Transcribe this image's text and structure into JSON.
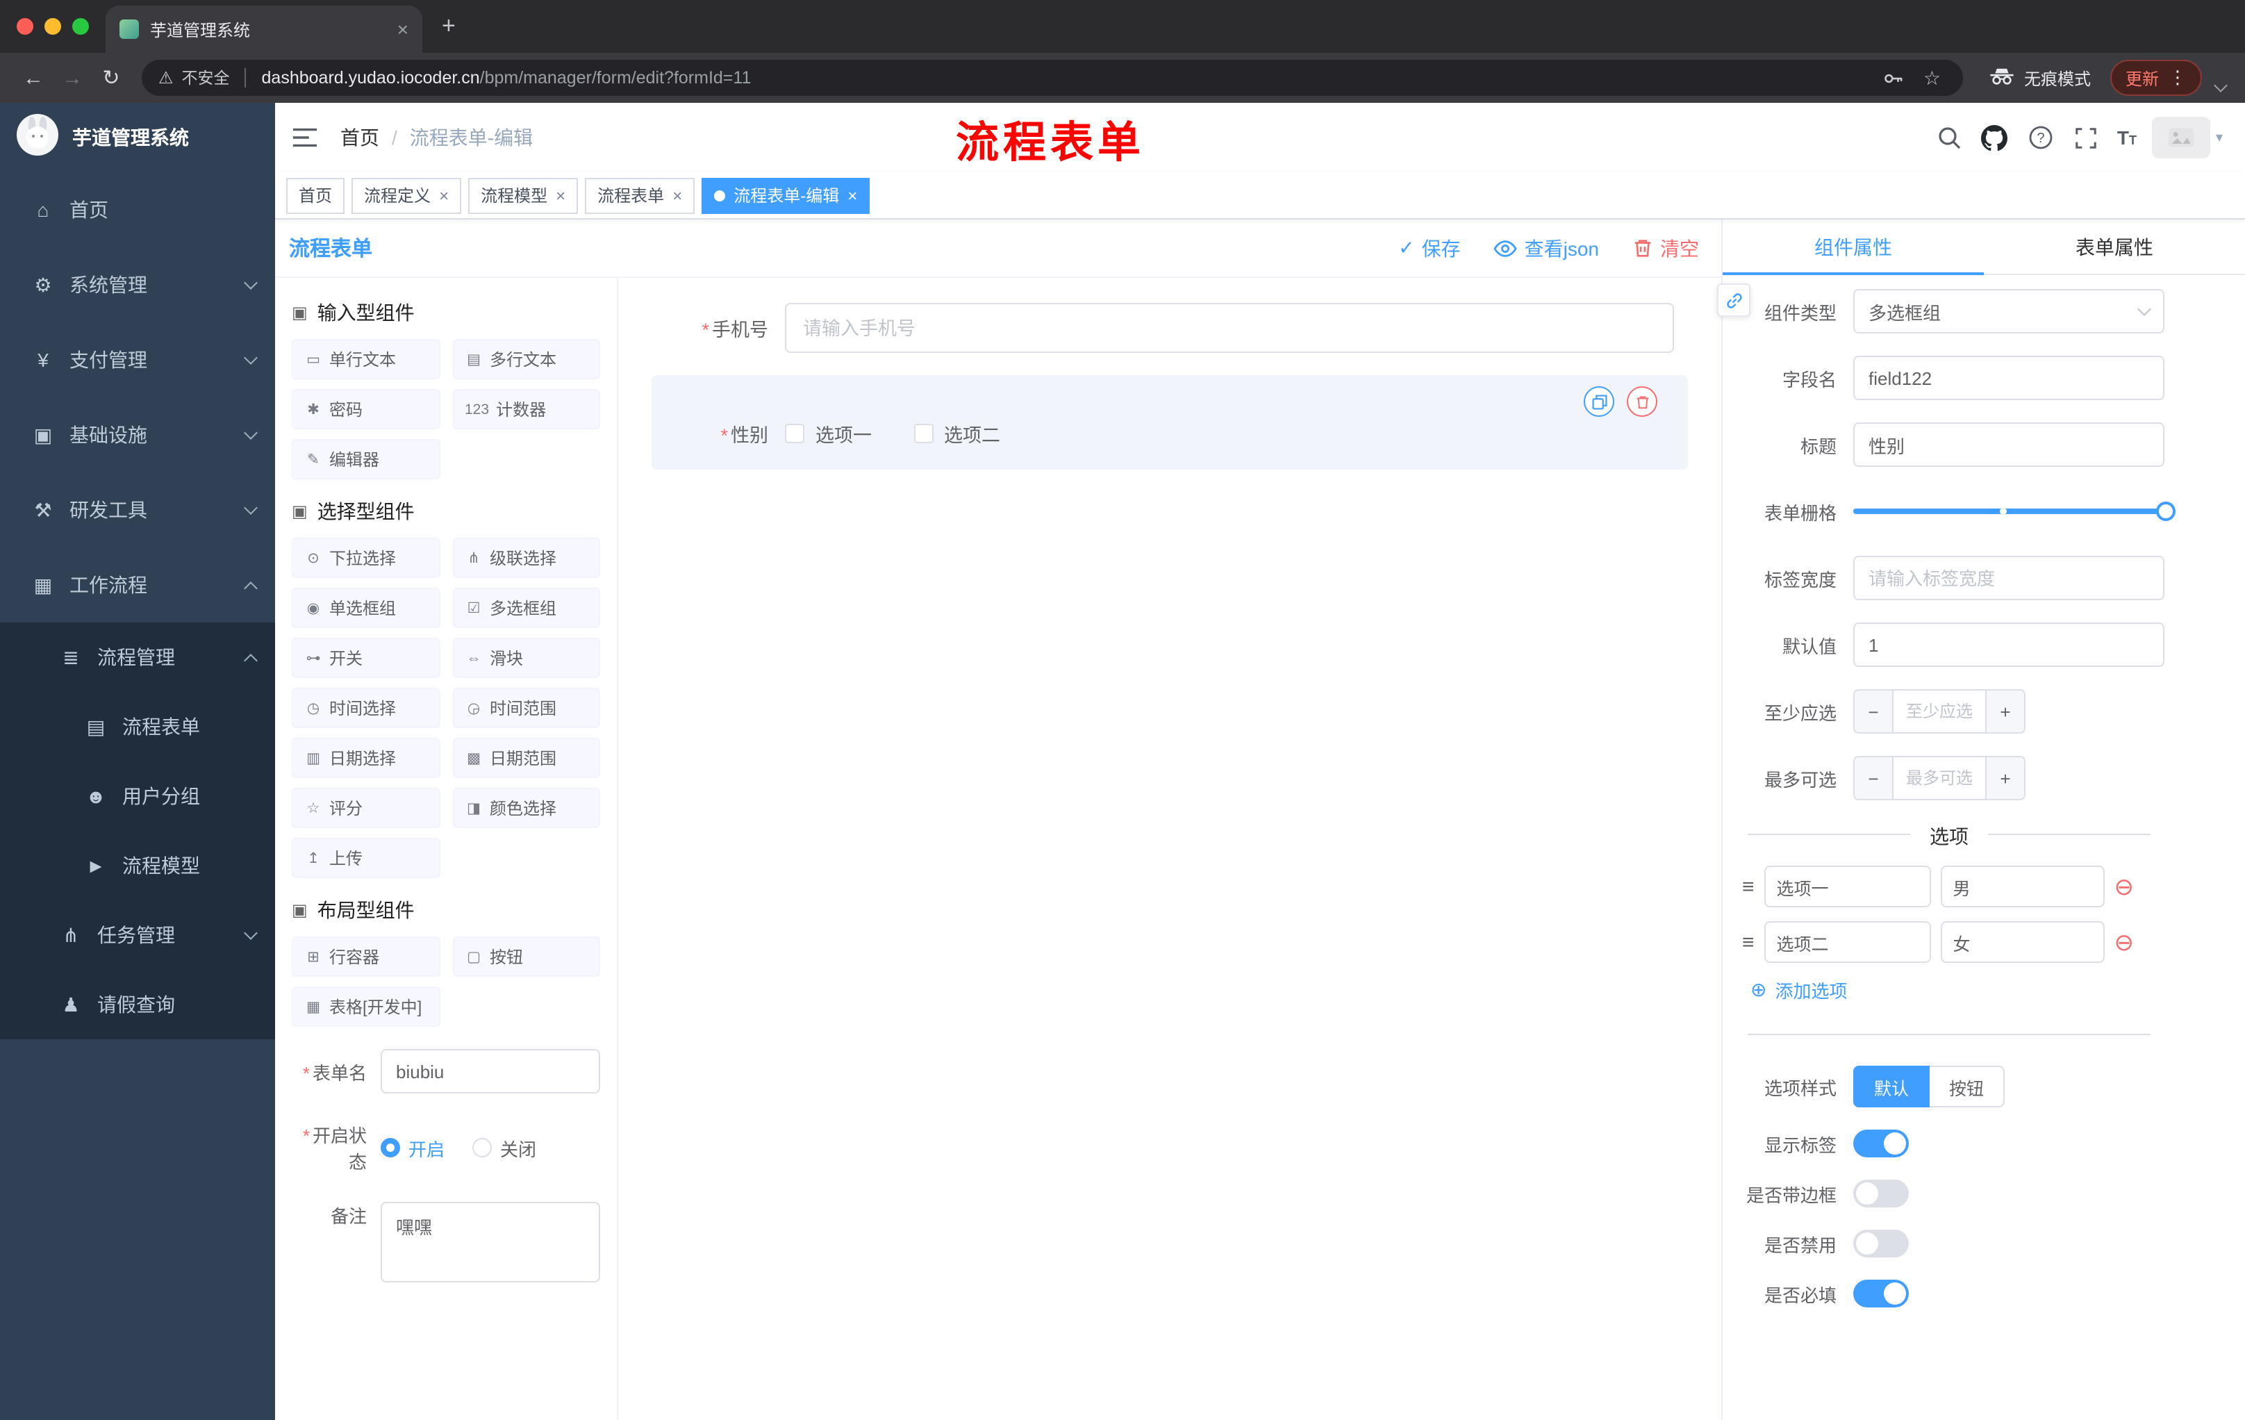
{
  "browser": {
    "tab_title": "芋道管理系统",
    "security_label": "不安全",
    "url_host": "dashboard.yudao.iocoder.cn",
    "url_path": "/bpm/manager/form/edit?formId=11",
    "incognito_label": "无痕模式",
    "update_label": "更新"
  },
  "sidebar": {
    "logo_title": "芋道管理系统",
    "items": [
      {
        "label": "首页"
      },
      {
        "label": "系统管理"
      },
      {
        "label": "支付管理"
      },
      {
        "label": "基础设施"
      },
      {
        "label": "研发工具"
      },
      {
        "label": "工作流程"
      },
      {
        "label": "流程管理"
      },
      {
        "label": "流程表单"
      },
      {
        "label": "用户分组"
      },
      {
        "label": "流程模型"
      },
      {
        "label": "任务管理"
      },
      {
        "label": "请假查询"
      }
    ]
  },
  "header": {
    "breadcrumb_home": "首页",
    "breadcrumb_sep": "/",
    "breadcrumb_current": "流程表单-编辑",
    "annotation": "流程表单"
  },
  "tags": [
    {
      "label": "首页"
    },
    {
      "label": "流程定义"
    },
    {
      "label": "流程模型"
    },
    {
      "label": "流程表单"
    },
    {
      "label": "流程表单-编辑"
    }
  ],
  "designer": {
    "title": "流程表单",
    "save_label": "保存",
    "view_json_label": "查看json",
    "clear_label": "清空",
    "groups": [
      {
        "title": "输入型组件",
        "items": [
          "单行文本",
          "多行文本",
          "密码",
          "计数器",
          "编辑器"
        ]
      },
      {
        "title": "选择型组件",
        "items": [
          "下拉选择",
          "级联选择",
          "单选框组",
          "多选框组",
          "开关",
          "滑块",
          "时间选择",
          "时间范围",
          "日期选择",
          "日期范围",
          "评分",
          "颜色选择",
          "上传"
        ]
      },
      {
        "title": "布局型组件",
        "items": [
          "行容器",
          "按钮",
          "表格[开发中]"
        ]
      }
    ],
    "meta": {
      "form_name_label": "表单名",
      "form_name_value": "biubiu",
      "status_label": "开启状态",
      "status_on": "开启",
      "status_off": "关闭",
      "remark_label": "备注",
      "remark_value": "嘿嘿"
    },
    "canvas": {
      "phone_label": "手机号",
      "phone_placeholder": "请输入手机号",
      "gender_label": "性别",
      "gender_option_1": "选项一",
      "gender_option_2": "选项二"
    }
  },
  "props": {
    "tab_component": "组件属性",
    "tab_form": "表单属性",
    "rows": {
      "type_label": "组件类型",
      "type_value": "多选框组",
      "field_label": "字段名",
      "field_value": "field122",
      "title_label": "标题",
      "title_value": "性别",
      "grid_label": "表单栅格",
      "tagwidth_label": "标签宽度",
      "tagwidth_placeholder": "请输入标签宽度",
      "default_label": "默认值",
      "default_value": "1",
      "min_label": "至少应选",
      "min_placeholder": "至少应选",
      "max_label": "最多可选",
      "max_placeholder": "最多可选"
    },
    "options_divider": "选项",
    "options": [
      {
        "label": "选项一",
        "value": "男"
      },
      {
        "label": "选项二",
        "value": "女"
      }
    ],
    "add_option_label": "添加选项",
    "style_label": "选项样式",
    "style_default": "默认",
    "style_button": "按钮",
    "toggles": [
      {
        "label": "显示标签",
        "on": true
      },
      {
        "label": "是否带边框",
        "on": false
      },
      {
        "label": "是否禁用",
        "on": false
      },
      {
        "label": "是否必填",
        "on": true
      }
    ]
  },
  "ui": {
    "required_marker": "*"
  },
  "colors": {
    "accent": "#409eff",
    "danger": "#f56c6c",
    "annotation_red": "#fb0400",
    "sidebar_bg": "#304156",
    "submenu_bg": "#1f2d3d"
  },
  "icons": {
    "close": "×",
    "plus": "+",
    "back": "←",
    "forward": "→",
    "reload": "↻",
    "warning": "⚠",
    "star": "☆",
    "dots": "⋮",
    "caret": "▾",
    "home": "⌂",
    "gear": "⚙",
    "money": "¥",
    "infra": "▣",
    "tools": "⚒",
    "workflow": "▦",
    "process": "≣",
    "form": "▤",
    "users": "☻",
    "model": "►",
    "task": "⋔",
    "person": "♟",
    "group_header": "▣",
    "single_line": "▭",
    "multi_line": "▤",
    "lock": "✱",
    "counter": "123",
    "editor": "✎",
    "select": "⊙",
    "cascader": "⋔",
    "radio": "◉",
    "checkbox": "☑",
    "switch": "⊶",
    "slider": "⇔",
    "time": "◷",
    "time_range": "◶",
    "date": "▥",
    "date_range": "▩",
    "rate": "☆",
    "color": "◨",
    "upload": "↥",
    "row": "⊞",
    "button": "▢",
    "table": "▦",
    "check": "✓",
    "drag": "≡",
    "minus": "−",
    "minus_circle": "⊖",
    "plus_circle": "⊕"
  }
}
